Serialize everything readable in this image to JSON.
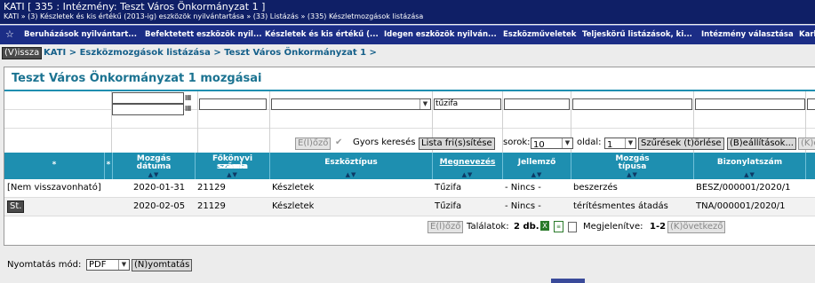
{
  "titlebar": {
    "title": "KATI [ 335 : Intézmény: Teszt Város Önkormányzat 1 ]",
    "path": "KATI » (3) Készletek és kis értékű (2013-ig) eszközök nyilvántartása » (33) Listázás » (335) Készletmozgások listázása"
  },
  "menu": {
    "star": "☆",
    "items": [
      "Beruházások nyilvántart...",
      "Befektetett eszközök nyil...",
      "Készletek és kis értékű (...",
      "Idegen eszközök nyilván...",
      "Eszközműveletek",
      "Teljeskörű listázások, ki...",
      "Intézmény választása",
      "Karb"
    ]
  },
  "nav": {
    "back_label": "(V)issza",
    "breadcrumb": "KATI > Eszközmozgások listázása > Teszt Város Önkormányzat 1 >"
  },
  "panel": {
    "title": "Teszt Város Önkormányzat 1 mozgásai"
  },
  "filters": {
    "description_value": "tűzifa"
  },
  "toolbar": {
    "prev_label": "E(l)őző",
    "quick_search_label": "Gyors keresés",
    "refresh_label": "Lista fri(s)sítése",
    "rows_label": "sorok:",
    "rows_value": "10",
    "page_label": "oldal:",
    "page_value": "1",
    "clear_filters_label": "Szűrések (t)örlése",
    "settings_label": "(B)eállítások...",
    "next_label": "(K)ö"
  },
  "table": {
    "headers": {
      "star1": "*",
      "star2": "*",
      "date_l1": "Mozgás",
      "date_l2": "dátuma",
      "account_l1": "Főkönyvi számla",
      "account_l2": "száma",
      "asset_type": "Eszköztípus",
      "description": "Megnevezés",
      "character": "Jellemző",
      "mtype_l1": "Mozgás",
      "mtype_l2": "típusa",
      "voucher": "Bizonylatszám"
    },
    "rows": [
      {
        "status": "[Nem visszavonható]",
        "date": "2020-01-31",
        "account": "21129",
        "asset_type": "Készletek",
        "description": "Tűzifa",
        "character": "- Nincs -",
        "movement_type": "beszerzés",
        "voucher": "BESZ/000001/2020/1"
      },
      {
        "status": "St.",
        "date": "2020-02-05",
        "account": "21129",
        "asset_type": "Készletek",
        "description": "Tűzifa",
        "character": "- Nincs -",
        "movement_type": "térítésmentes átadás",
        "voucher": "TNÁ/000001/2020/1"
      }
    ]
  },
  "pager": {
    "prev_label": "E(l)őző",
    "results_label": "Találatok:",
    "results_value": "2 db.",
    "shown_label": "Megjelenítve:",
    "shown_value": "1-2",
    "next_label": "(K)övetkező"
  },
  "print": {
    "mode_label": "Nyomtatás mód:",
    "mode_value": "PDF",
    "print_label": "(N)yomtatás"
  },
  "colors": {
    "titlebar": "#0f1f66",
    "menubar": "#1b2d86",
    "header": "#1e8fb0",
    "title_text": "#1b7391"
  }
}
